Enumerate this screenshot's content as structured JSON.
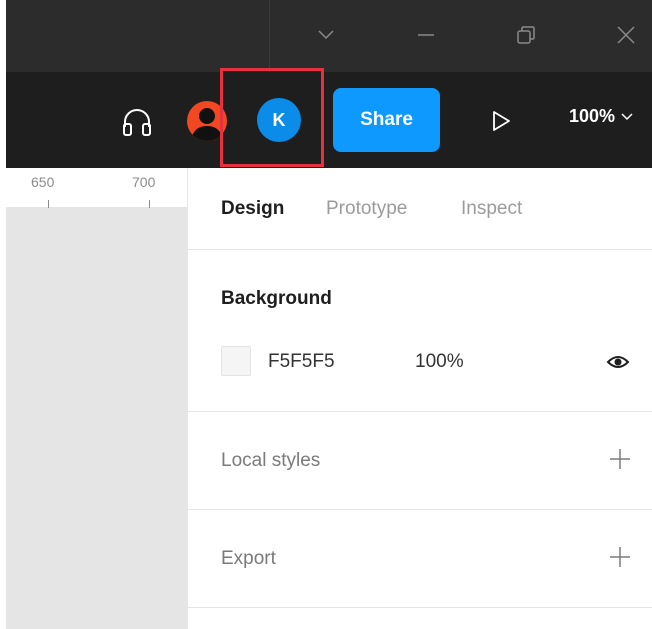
{
  "window_controls": {
    "dropdown_icon": "chevron-down-icon",
    "minimize_icon": "minimize-icon",
    "restore_icon": "restore-icon",
    "close_icon": "close-icon"
  },
  "toolbar": {
    "audio_icon": "headphones-icon",
    "current_user_avatar": "avatar-icon",
    "collaborator_initial": "K",
    "share_label": "Share",
    "present_icon": "play-icon",
    "zoom_value": "100%"
  },
  "ruler": {
    "labels": [
      "650",
      "700"
    ]
  },
  "panel": {
    "tabs": [
      "Design",
      "Prototype",
      "Inspect"
    ],
    "background": {
      "title": "Background",
      "color_hex": "F5F5F5",
      "opacity": "100%",
      "swatch_color": "#f5f5f5",
      "visibility_icon": "eye-icon"
    },
    "local_styles": {
      "title": "Local styles"
    },
    "export": {
      "title": "Export"
    }
  },
  "colors": {
    "accent": "#0d99ff",
    "collaborator": "#0c8ce9",
    "user": "#f24822",
    "highlight": "#e8313f",
    "toolbar_bg": "#1e1e1e",
    "titlebar_bg": "#2c2c2c"
  }
}
